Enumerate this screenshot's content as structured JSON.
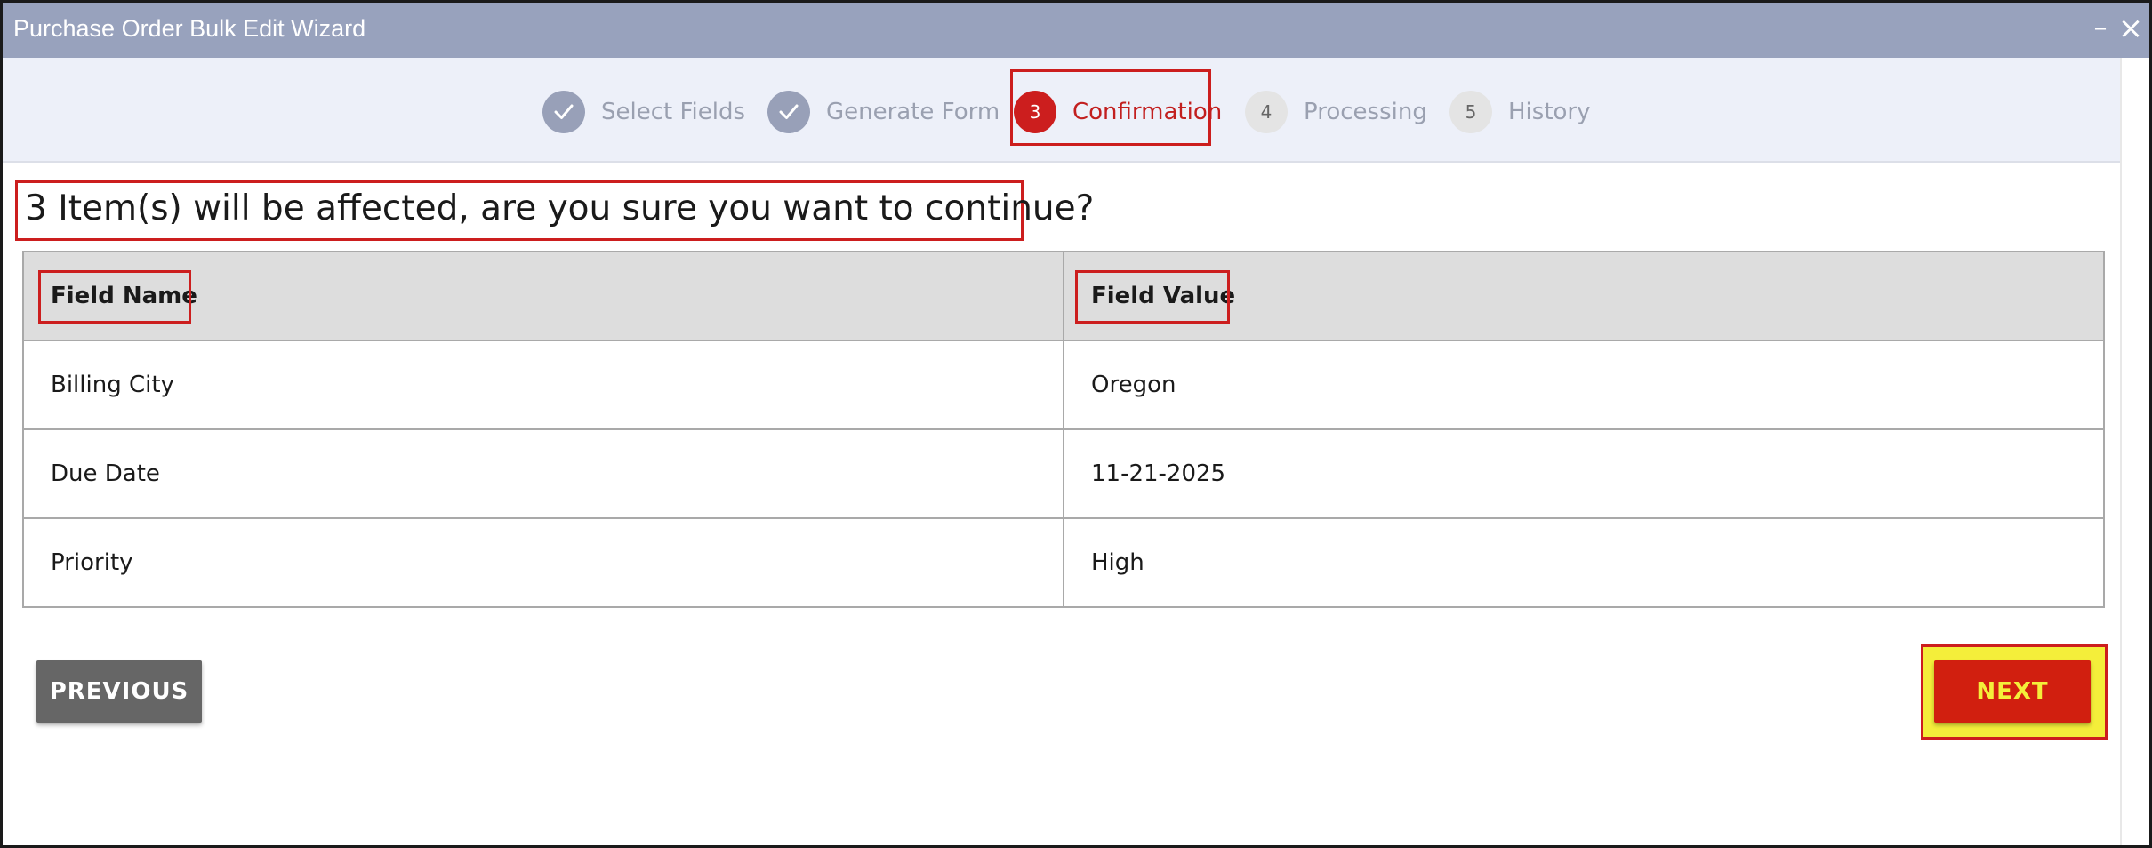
{
  "window": {
    "title": "Purchase Order Bulk Edit Wizard",
    "minimize_icon": "minimize-icon",
    "close_icon": "close-icon"
  },
  "steps": [
    {
      "number": "1",
      "label": "Select Fields",
      "state": "done"
    },
    {
      "number": "2",
      "label": "Generate Form",
      "state": "done"
    },
    {
      "number": "3",
      "label": "Confirmation",
      "state": "active"
    },
    {
      "number": "4",
      "label": "Processing",
      "state": "todo"
    },
    {
      "number": "5",
      "label": "History",
      "state": "todo"
    }
  ],
  "confirm": {
    "message": "3 Item(s) will be affected, are you sure you want to continue?"
  },
  "table": {
    "headers": {
      "name": "Field Name",
      "value": "Field Value"
    },
    "rows": [
      {
        "name": "Billing City",
        "value": "Oregon"
      },
      {
        "name": "Due Date",
        "value": "11-21-2025"
      },
      {
        "name": "Priority",
        "value": "High"
      }
    ]
  },
  "actions": {
    "previous_label": "PREVIOUS",
    "next_label": "NEXT"
  },
  "colors": {
    "titlebar": "#98a2bd",
    "active_step": "#cc1e1e",
    "next_button": "#d11f0f",
    "highlight": "#f4ee3a"
  }
}
